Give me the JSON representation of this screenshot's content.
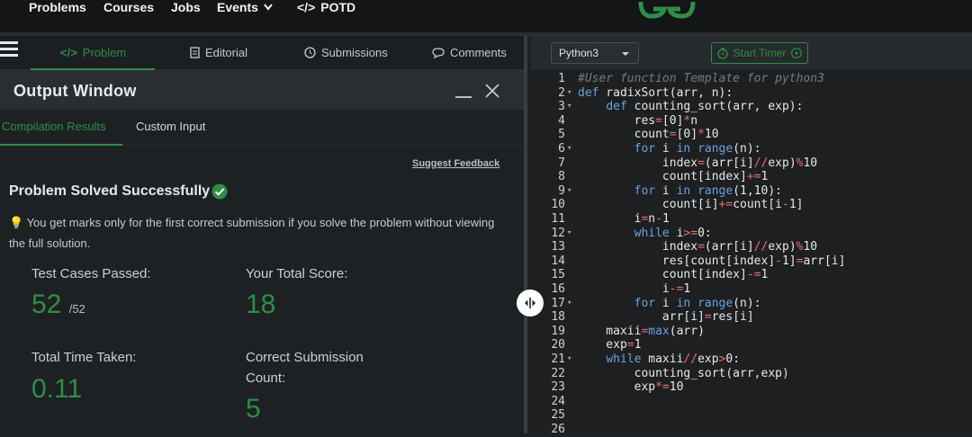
{
  "nav": {
    "items": [
      "Problems",
      "Courses",
      "Jobs",
      "Events",
      "POTD"
    ]
  },
  "tabs": {
    "problem": "Problem",
    "editorial": "Editorial",
    "submissions": "Submissions",
    "comments": "Comments"
  },
  "output_window": {
    "title": "Output Window",
    "subtabs": [
      "Compilation Results",
      "Custom Input"
    ],
    "suggest_feedback": "Suggest Feedback",
    "status": "Problem Solved Successfully",
    "note": "You get marks only for the first correct submission if you solve the problem without viewing the full solution.",
    "stats": {
      "test_cases_label": "Test Cases Passed:",
      "test_cases_value": "52",
      "test_cases_total": "/52",
      "score_label": "Your Total Score:",
      "score_value": "18",
      "time_label": "Total Time Taken:",
      "time_value": "0.11",
      "correct_label_1": "Correct Submission",
      "correct_label_2": "Count:",
      "correct_value": "5"
    }
  },
  "editor": {
    "language": "Python3",
    "start_timer": "Start Timer",
    "lines": [
      "#User function Template for python3",
      "def radixSort(arr, n):",
      "    def counting_sort(arr, exp):",
      "        res=[0]*n",
      "        count=[0]*10",
      "        for i in range(n):",
      "            index=(arr[i]//exp)%10",
      "            count[index]+=1",
      "        for i in range(1,10):",
      "            count[i]+=count[i-1]",
      "        i=n-1",
      "        while i>=0:",
      "            index=(arr[i]//exp)%10",
      "            res[count[index]-1]=arr[i]",
      "            count[index]-=1",
      "            i-=1",
      "        for i in range(n):",
      "            arr[i]=res[i]",
      "    maxii=max(arr)",
      "    exp=1",
      "    while maxii//exp>0:",
      "        counting_sort(arr,exp)",
      "        exp*=10",
      "",
      "",
      ""
    ],
    "fold_lines": [
      2,
      3,
      6,
      9,
      12,
      17,
      21
    ]
  },
  "colors": {
    "accent": "#2f8d46",
    "keyword": "#66a3e0",
    "operator": "#e07070"
  }
}
